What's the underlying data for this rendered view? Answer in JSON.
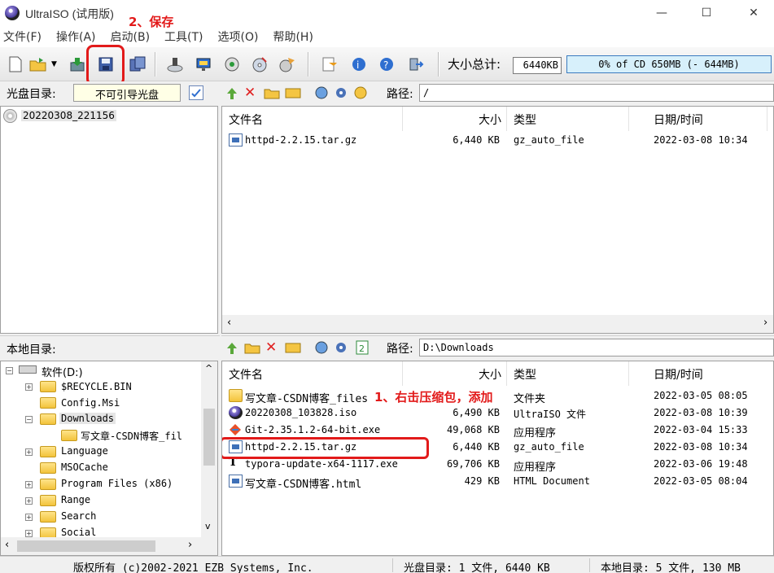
{
  "window": {
    "title": "UltraISO (试用版)",
    "minimize": "—",
    "maximize": "☐",
    "close": "✕"
  },
  "menu": [
    "文件(F)",
    "操作(A)",
    "启动(B)",
    "工具(T)",
    "选项(O)",
    "帮助(H)"
  ],
  "toolbar": {
    "size_label": "大小总计:",
    "size_value": "6440KB",
    "progress_text": "0% of CD 650MB (- 644MB)",
    "progress_fraction": 0.0
  },
  "disc_panel": {
    "label": "光盘目录:",
    "boot_field": "不可引导光盘",
    "tree": [
      "20220308_221156"
    ],
    "path_label": "路径:",
    "path": "/",
    "columns": [
      "文件名",
      "大小",
      "类型",
      "日期/时间",
      "I"
    ],
    "files": [
      {
        "name": "httpd-2.2.15.tar.gz",
        "size": "6,440 KB",
        "type": "gz_auto_file",
        "date": "2022-03-08 10:34"
      }
    ]
  },
  "local_panel": {
    "label": "本地目录:",
    "path_label": "路径:",
    "path": "D:\\Downloads",
    "tree": [
      {
        "label": "软件(D:)",
        "level": 0
      },
      {
        "label": "$RECYCLE.BIN",
        "level": 1
      },
      {
        "label": "Config.Msi",
        "level": 1
      },
      {
        "label": "Downloads",
        "level": 1
      },
      {
        "label": "写文章-CSDN博客_fil",
        "level": 2
      },
      {
        "label": "Language",
        "level": 1
      },
      {
        "label": "MSOCache",
        "level": 1
      },
      {
        "label": "Program Files (x86)",
        "level": 1
      },
      {
        "label": "Range",
        "level": 1
      },
      {
        "label": "Search",
        "level": 1
      },
      {
        "label": "Social",
        "level": 1
      }
    ],
    "columns": [
      "文件名",
      "大小",
      "类型",
      "日期/时间"
    ],
    "files": [
      {
        "name": "写文章-CSDN博客_files",
        "size": "",
        "type": "文件夹",
        "date": "2022-03-05 08:05"
      },
      {
        "name": "20220308_103828.iso",
        "size": "6,490 KB",
        "type": "UltraISO 文件",
        "date": "2022-03-08 10:39"
      },
      {
        "name": "Git-2.35.1.2-64-bit.exe",
        "size": "49,068 KB",
        "type": "应用程序",
        "date": "2022-03-04 15:33"
      },
      {
        "name": "httpd-2.2.15.tar.gz",
        "size": "6,440 KB",
        "type": "gz_auto_file",
        "date": "2022-03-08 10:34"
      },
      {
        "name": "typora-update-x64-1117.exe",
        "size": "69,706 KB",
        "type": "应用程序",
        "date": "2022-03-06 19:48"
      },
      {
        "name": "写文章-CSDN博客.html",
        "size": "429 KB",
        "type": "HTML Document",
        "date": "2022-03-05 08:04"
      }
    ]
  },
  "annotations": {
    "save": "2、保存",
    "add": "1、右击压缩包，添加"
  },
  "status": {
    "copyright": "版权所有 (c)2002-2021 EZB Systems, Inc.",
    "disc": "光盘目录: 1 文件, 6440 KB",
    "local": "本地目录: 5 文件, 130 MB"
  },
  "colors": {
    "annotation": "#e21a1a",
    "progress_fill": "#d7f0fb",
    "progress_border": "#3a7bbf"
  }
}
